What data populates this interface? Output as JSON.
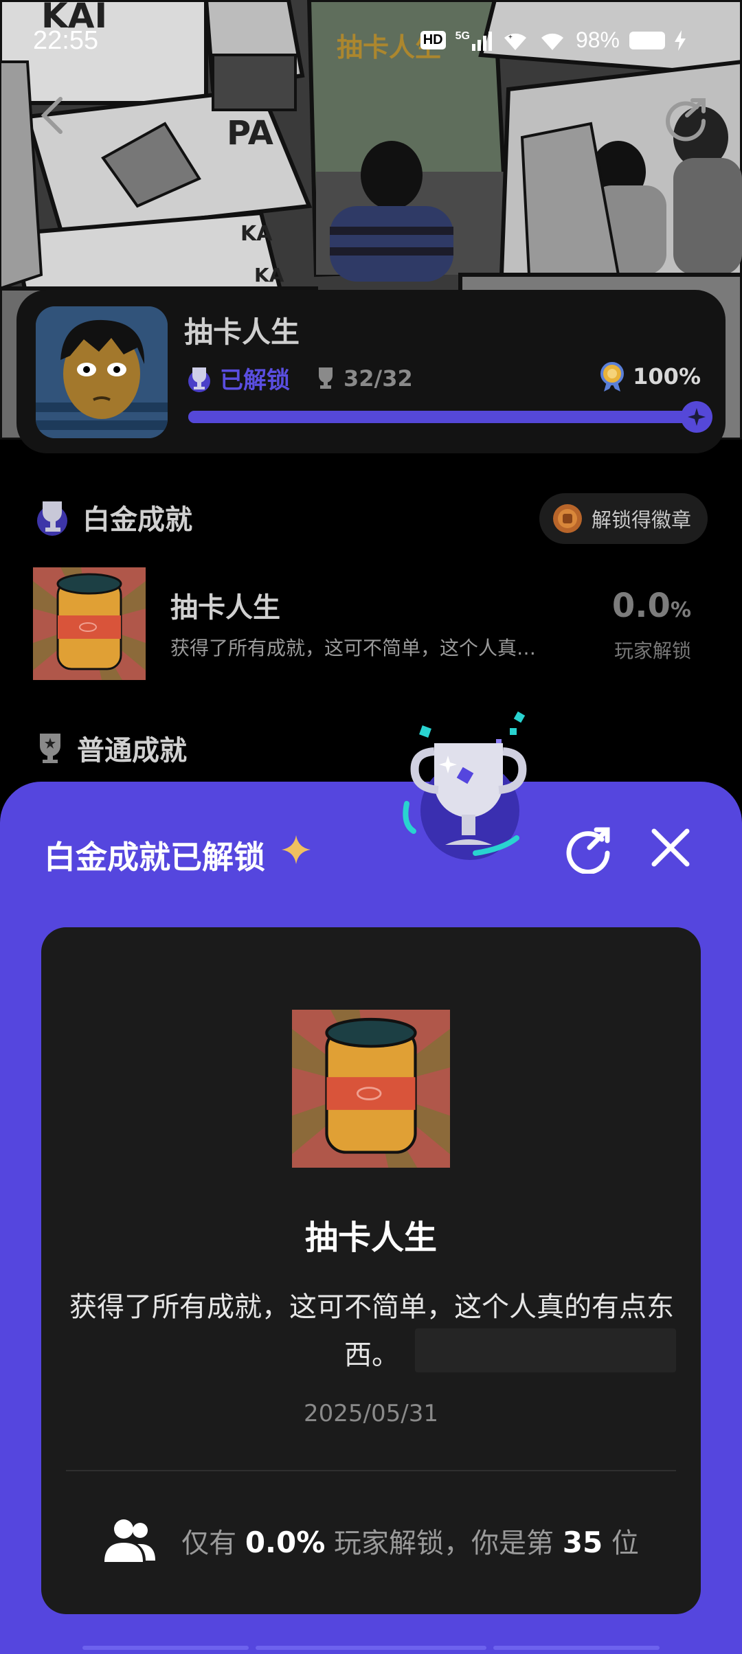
{
  "status_bar": {
    "time": "22:55",
    "center_text": "抽卡人生",
    "network": "5G",
    "hd": "HD",
    "battery": "98%"
  },
  "game": {
    "name": "抽卡人生",
    "unlocked_label": "已解锁",
    "trophy_count": "32/32",
    "completion": "100%",
    "progress_fraction": 1.0
  },
  "platinum_section": {
    "title": "白金成就",
    "badge_button": "解锁得徽章",
    "item": {
      "name": "抽卡人生",
      "description": "获得了所有成就，这可不简单，这个人真…",
      "rate_value": "0.0",
      "rate_unit": "%",
      "rate_label": "玩家解锁"
    }
  },
  "normal_section": {
    "title": "普通成就"
  },
  "sheet": {
    "title": "白金成就已解锁",
    "card": {
      "name": "抽卡人生",
      "description": "获得了所有成就，这可不简单，这个人真的有点东西。",
      "date": "2025/05/31",
      "footer_prefix": "仅有",
      "footer_rate": "0.0%",
      "footer_middle": "玩家解锁，你是第",
      "footer_rank": "35",
      "footer_suffix": "位"
    }
  },
  "colors": {
    "accent": "#5546de",
    "card": "#1b1b1b",
    "background": "#000000"
  }
}
